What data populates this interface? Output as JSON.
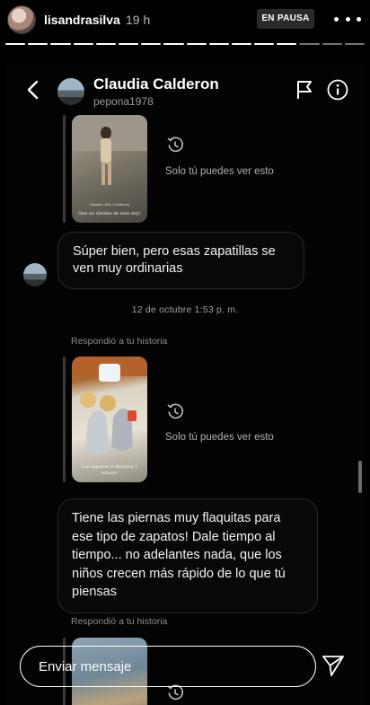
{
  "story": {
    "username": "lisandrasilva",
    "time": "19 h",
    "pause_label": "EN PAUSA",
    "segments_total": 16,
    "segments_done": 13
  },
  "dm": {
    "contact_name": "Claudia Calderon",
    "contact_handle": "pepona1978",
    "only_you_text": "Solo tú puedes ver esto",
    "messages": [
      {
        "text": "Súper bien, pero esas zapatillas se ven muy ordinarias"
      },
      {
        "text": "Tiene las piernas muy flaquitas para ese tipo de zapatos! Dale tiempo al tiempo... no adelantes nada, que los niños crecen más rápido de lo que tú piensas"
      }
    ],
    "timestamp": "12 de octubre 1:53 p. m.",
    "replied_label": "Respondió a tu historia",
    "thumb_captions": [
      "Que no olvides de este day!",
      "Los zapatos le duraron 1 minuto"
    ],
    "thumb_handle": "Claudia • Elia • Guillermo"
  },
  "composer": {
    "placeholder": "Enviar mensaje"
  },
  "colors": {
    "background": "#000000",
    "bubble_border": "#2a2a2a",
    "muted_text": "#9a9a9a"
  },
  "icons": [
    "back-arrow-icon",
    "flag-icon",
    "info-icon",
    "replay-icon",
    "send-icon",
    "more-icon"
  ]
}
